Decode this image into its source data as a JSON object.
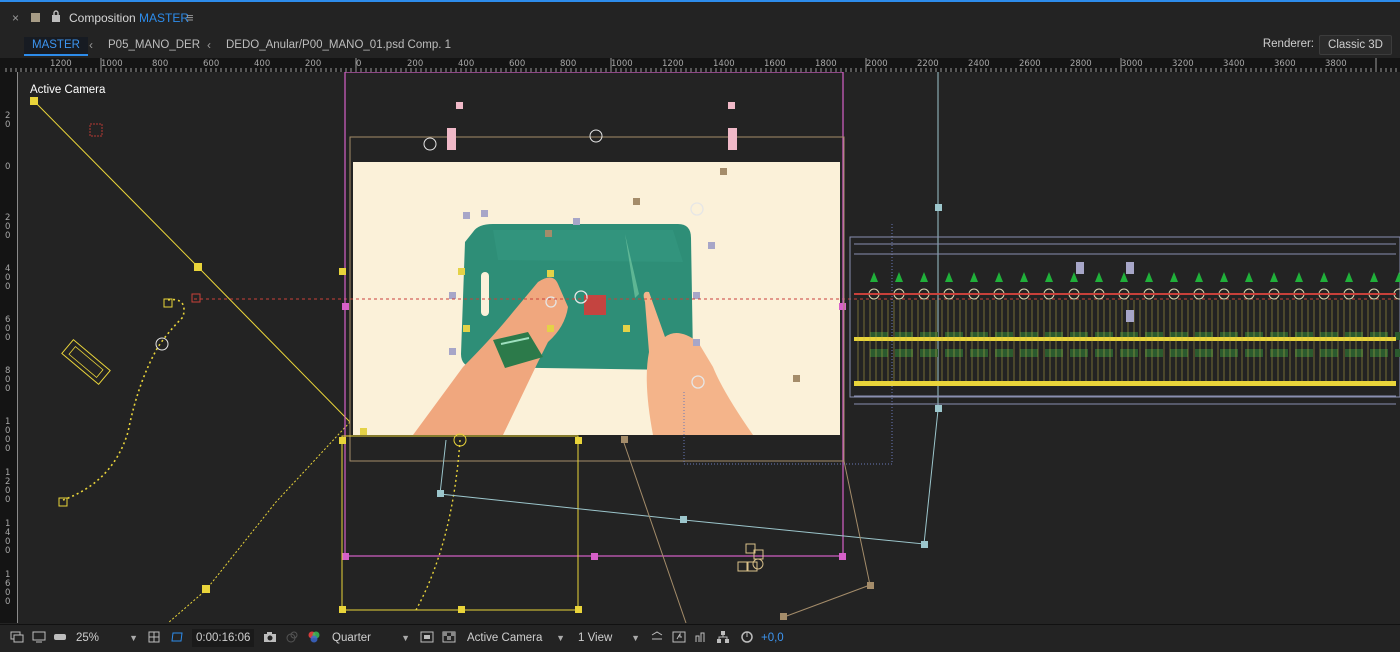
{
  "panel": {
    "close_glyph": "×",
    "title_prefix": "Composition",
    "title_comp": "MASTER",
    "menu_glyph": "≡",
    "accent_color": "#2d8ceb"
  },
  "breadcrumbs": {
    "items": [
      "MASTER",
      "P05_MANO_DER",
      "DEDO_Anular/P00_MANO_01.psd Comp. 1"
    ],
    "separator": "‹"
  },
  "renderer": {
    "label": "Renderer:",
    "value": "Classic 3D"
  },
  "ruler_top": [
    "1200",
    "1000",
    "800",
    "600",
    "400",
    "200",
    "0",
    "200",
    "400",
    "600",
    "800",
    "1000",
    "1200",
    "1400",
    "1600",
    "1800",
    "2000",
    "2200",
    "2400",
    "2600",
    "2800",
    "3000",
    "3200",
    "3400",
    "3600",
    "3800"
  ],
  "ruler_left": [
    "2\n0",
    "0",
    "2\n0\n0",
    "4\n0\n0",
    "6\n0\n0",
    "8\n0\n0",
    "1\n0\n0\n0",
    "1\n2\n0\n0",
    "1\n4\n0\n0",
    "1\n6\n0\n0"
  ],
  "viewer": {
    "view_label": "Active Camera"
  },
  "toolbar": {
    "magnification": "25%",
    "timecode": "0:00:16:06",
    "resolution": "Quarter",
    "view_camera": "Active Camera",
    "view_layout": "1 View",
    "exposure": "+0,0",
    "chevron": "⌄"
  },
  "colors": {
    "background": "#232323",
    "comp_bg": "#fbf1d9",
    "board_green": "#2e8e77",
    "hand_skin": "#f0a77e",
    "wristband": "#2c7a4a",
    "path_yellow": "#e9d43a",
    "frame_magenta": "#d660c9",
    "path_tan": "#a48c6a",
    "path_lightblue": "#9cc6cc"
  }
}
